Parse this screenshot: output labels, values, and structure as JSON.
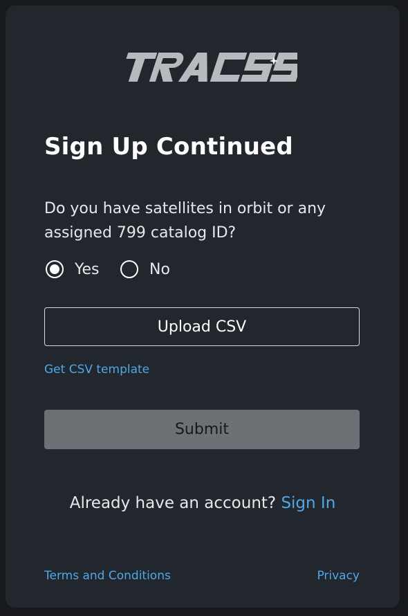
{
  "brand": {
    "logo_text": "TRACSS",
    "logo_color": "#b8babd"
  },
  "form": {
    "title": "Sign Up Continued",
    "question": "Do you have satellites in orbit or any assigned 799 catalog ID?",
    "options": [
      {
        "label": "Yes",
        "selected": true
      },
      {
        "label": "No",
        "selected": false
      }
    ],
    "upload_label": "Upload CSV",
    "template_link": "Get CSV template",
    "submit_label": "Submit"
  },
  "signin": {
    "prompt": "Already have an account?",
    "link": "Sign In"
  },
  "footer": {
    "terms": "Terms and Conditions",
    "privacy": "Privacy"
  },
  "colors": {
    "background": "#17191c",
    "card": "#22272e",
    "link": "#4fa8e6",
    "submit_disabled": "#6d7075"
  }
}
